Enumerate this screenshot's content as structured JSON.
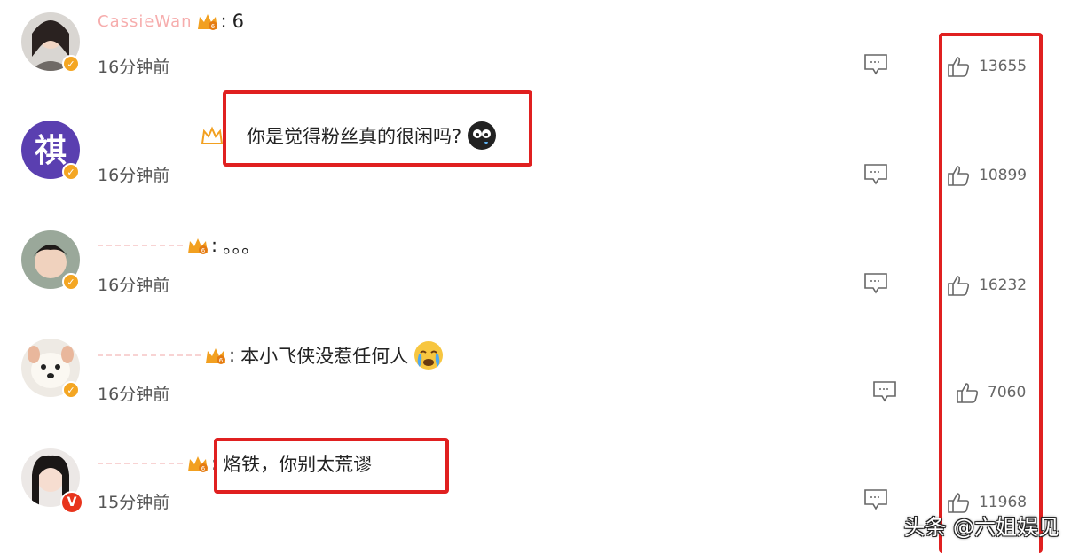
{
  "comments": [
    {
      "username": "CassieWan",
      "text": "6",
      "time": "16分钟前",
      "likes": "13655"
    },
    {
      "username": "",
      "text": "你是觉得粉丝真的很闲吗?",
      "time": "16分钟前",
      "likes": "10899"
    },
    {
      "username": "",
      "text": "。。。",
      "time": "16分钟前",
      "likes": "16232"
    },
    {
      "username": "",
      "text": "本小飞侠没惹任何人",
      "time": "16分钟前",
      "likes": "7060"
    },
    {
      "username": "",
      "text": "烙铁，你别太荒谬",
      "time": "15分钟前",
      "likes": "11968"
    }
  ],
  "colon": ":",
  "watermark": "头条 @六姐娱见",
  "colors": {
    "highlight_box": "#e02020",
    "verify_badge": "#f4a623",
    "verify_badge_red": "#e8341c",
    "username": "#f06b6b"
  }
}
